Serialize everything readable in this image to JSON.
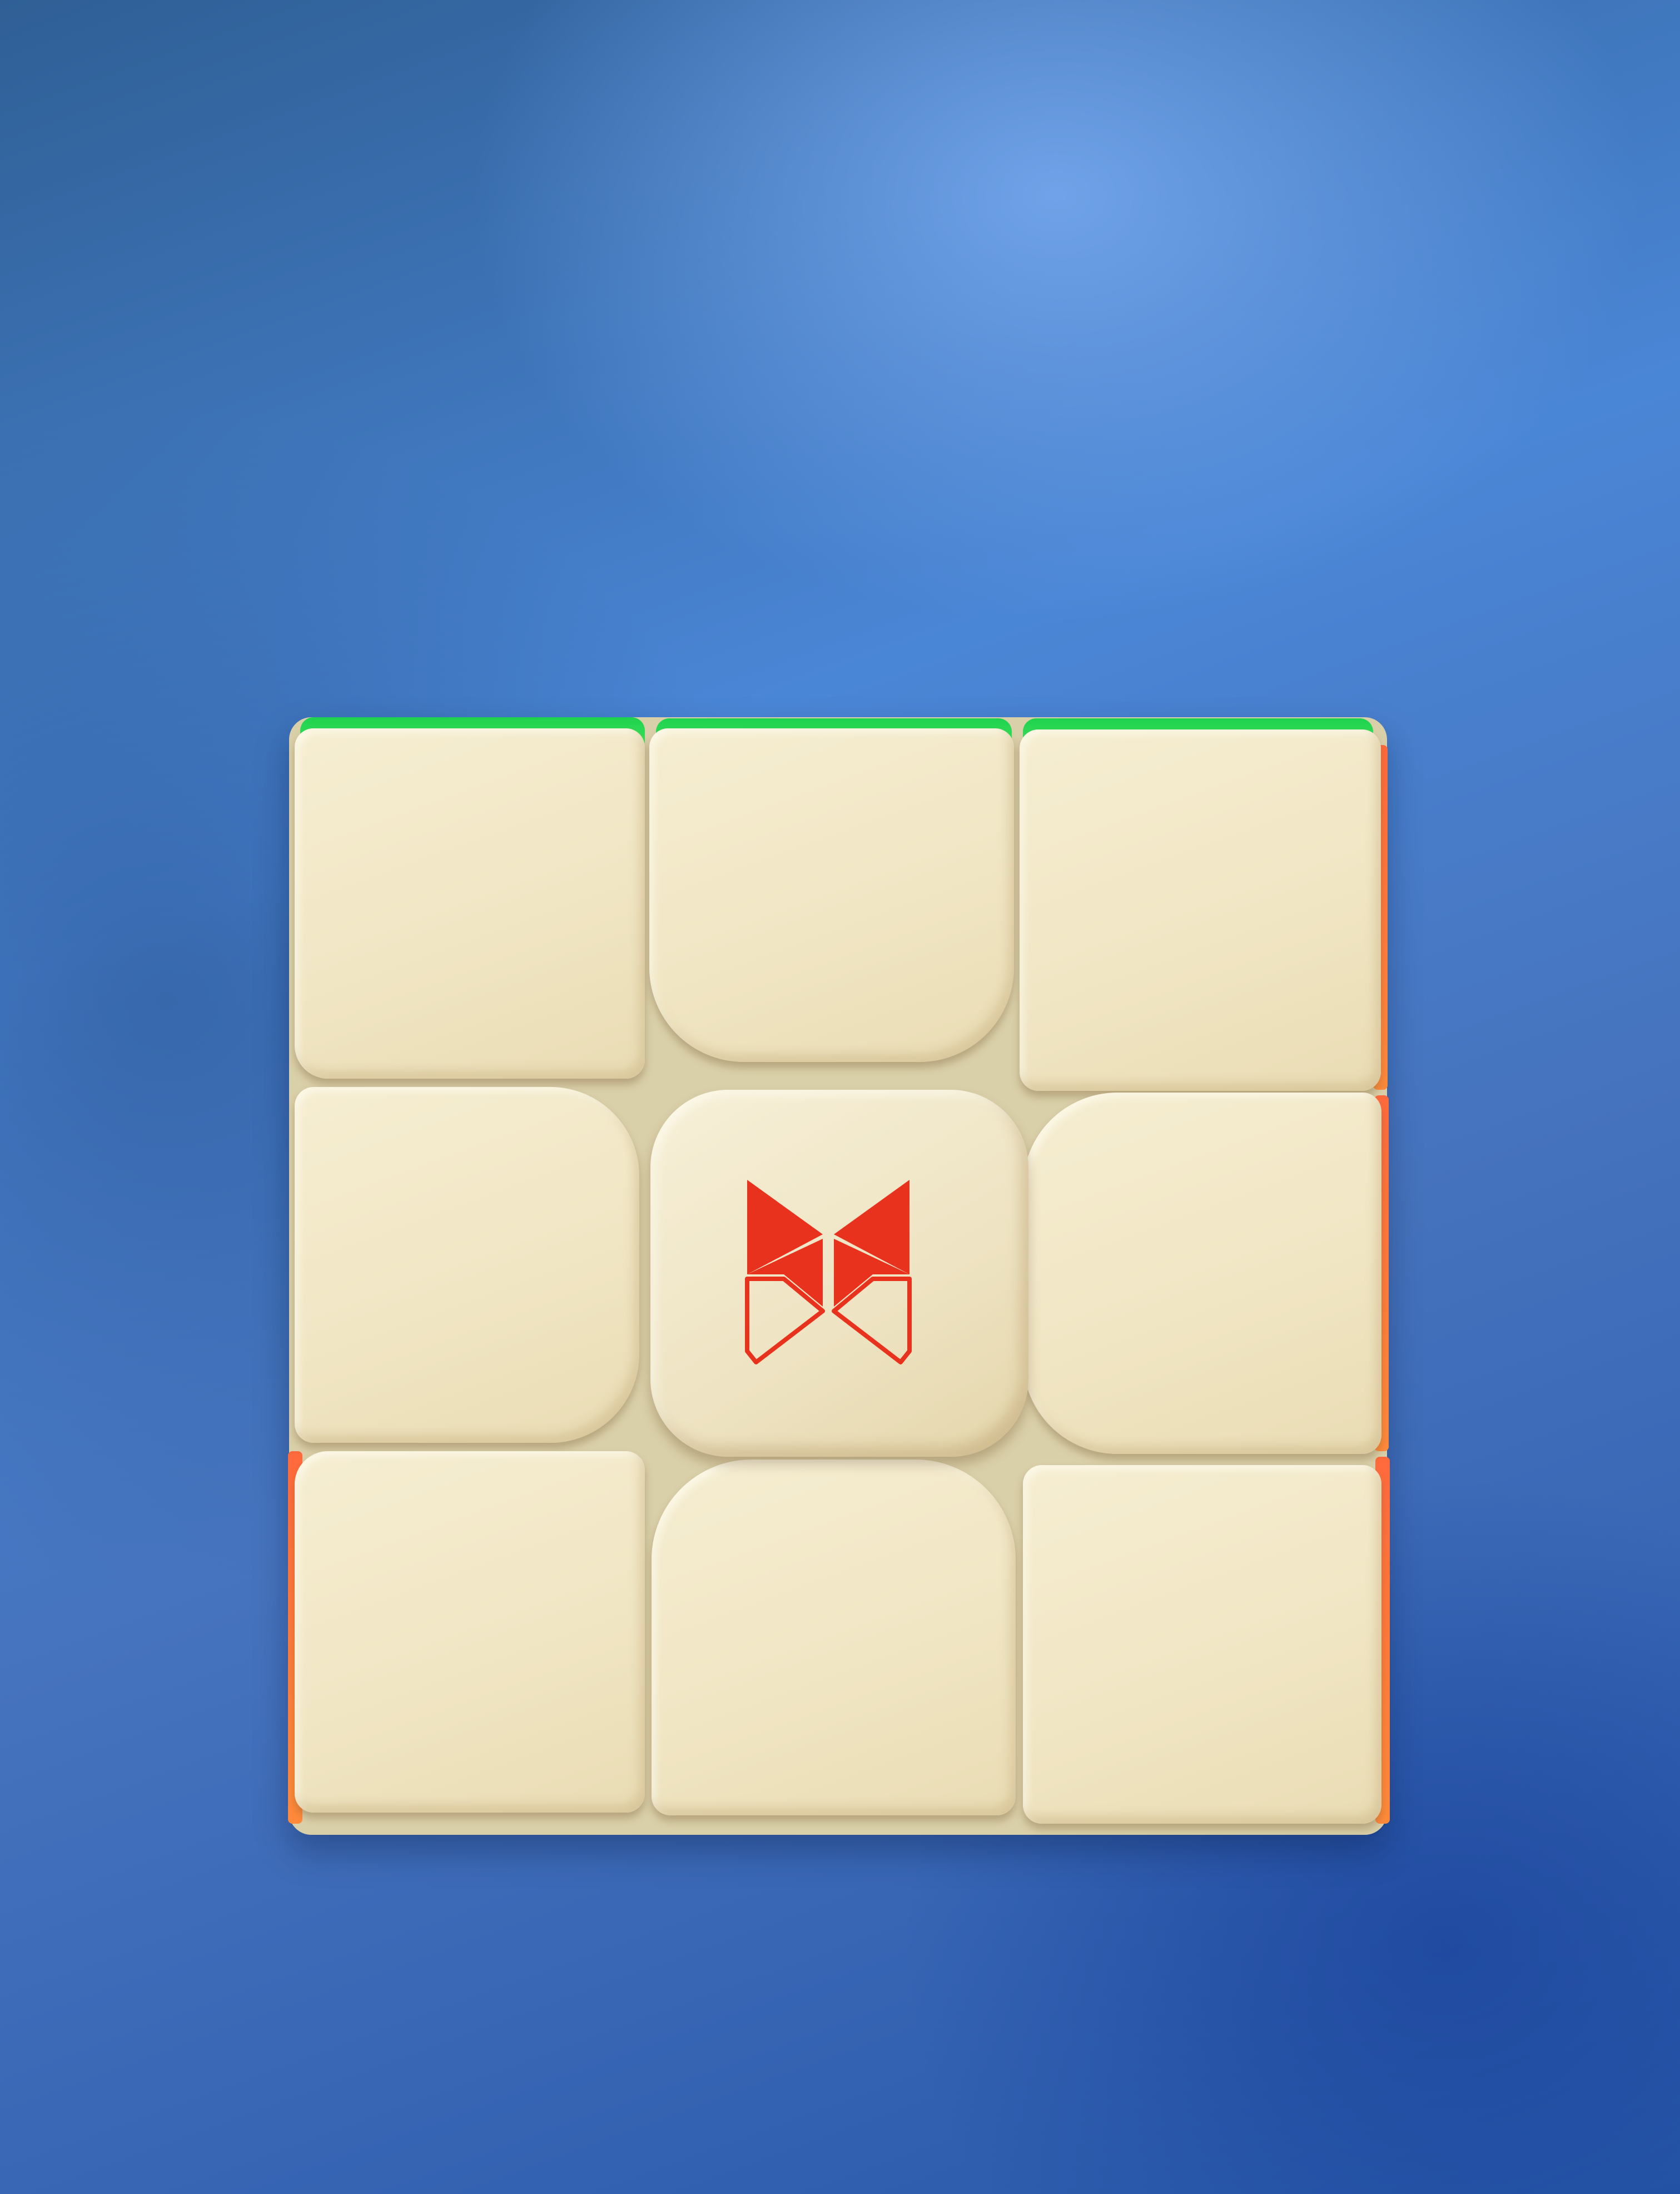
{
  "scene": {
    "background_color": "#4a7fcf",
    "subject": "puzzle-cube",
    "sticker_colors": {
      "face": "#f3e9c8",
      "top_edge": "#2fdc55",
      "side_edge": "#ff7a3a",
      "logo": "#e8321e"
    },
    "icons": [
      "butterfly-logo-icon"
    ]
  }
}
